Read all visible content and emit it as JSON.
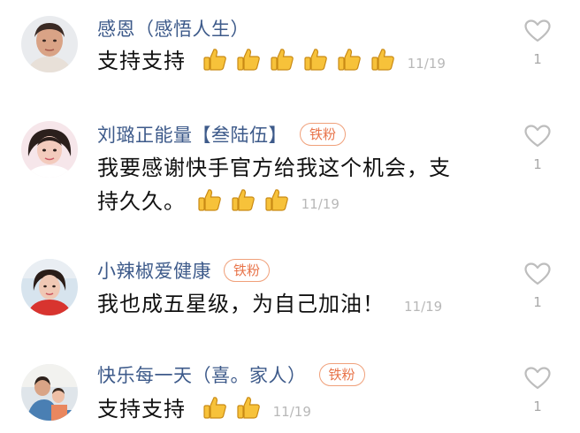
{
  "comments": [
    {
      "username": "感恩（感悟人生）",
      "badge": "",
      "text": "支持支持",
      "thumbs": 6,
      "date": "11/19",
      "likes": "1",
      "avatar_icon": "avatar-photo-woman"
    },
    {
      "username": "刘璐正能量【叁陆伍】",
      "badge": "铁粉",
      "text_line1": "我要感谢快手官方给我这个机会，支",
      "text_line2": "持久久。",
      "thumbs": 3,
      "date": "11/19",
      "likes": "1",
      "avatar_icon": "avatar-photo-woman"
    },
    {
      "username": "小辣椒爱健康",
      "badge": "铁粉",
      "text": "我也成五星级，为自己加油！",
      "thumbs": 0,
      "date": "11/19",
      "likes": "1",
      "avatar_icon": "avatar-photo-woman"
    },
    {
      "username": "快乐每一天（喜。家人）",
      "badge": "铁粉",
      "text": "支持支持",
      "thumbs": 2,
      "date": "11/19",
      "likes": "1",
      "avatar_icon": "avatar-photo-family"
    }
  ],
  "icons": {
    "like": "heart-outline-icon",
    "emoji": "thumbs-up-emoji"
  },
  "colors": {
    "username": "#3d5a8a",
    "badge": "#e8744a",
    "timestamp": "#b8b8b8",
    "heart": "#bdbdbd"
  }
}
